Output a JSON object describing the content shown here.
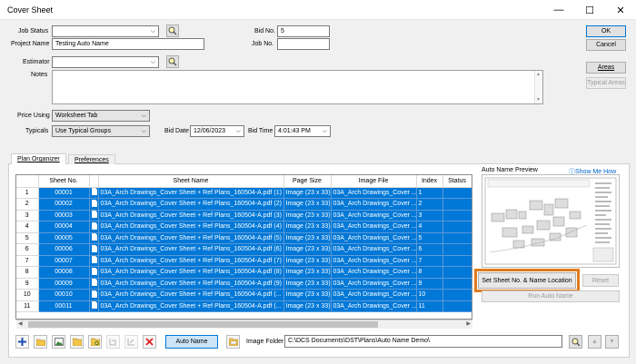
{
  "window": {
    "title": "Cover Sheet",
    "min": "—",
    "max": "☐",
    "close": "✕"
  },
  "form": {
    "job_status_label": "Job Status",
    "job_status_value": "",
    "project_name_label": "Project Name",
    "project_name_value": "Testing Auto Name",
    "estimator_label": "Estimator",
    "estimator_value": "",
    "notes_label": "Notes",
    "notes_value": "",
    "bid_no_label": "Bid No.",
    "bid_no_value": "5",
    "job_no_label": "Job No.",
    "job_no_value": "",
    "price_using_label": "Price Using",
    "price_using_value": "Worksheet Tab",
    "typicals_label": "Typicals",
    "typicals_value": "Use Typical Groups",
    "bid_date_label": "Bid Date",
    "bid_date_value": "12/06/2023",
    "bid_time_label": "Bid Time",
    "bid_time_value": "4:01:43 PM"
  },
  "side_buttons": {
    "ok": "OK",
    "cancel": "Cancel",
    "areas": "Areas",
    "typical_areas": "Typical Areas"
  },
  "tabs": [
    {
      "label": "Plan Organizer",
      "active": true
    },
    {
      "label": "Preferences",
      "active": false
    }
  ],
  "grid": {
    "columns": [
      "",
      "Sheet No.",
      "",
      "Sheet Name",
      "Page Size",
      "Image File",
      "Index",
      "Status",
      "Re"
    ],
    "rows": [
      {
        "num": "1",
        "sheet": "00001",
        "name": "03A_Arch Drawings_Cover Sheet + Ref Plans_160504-A.pdf (1)",
        "size": "Image (23 x 33)",
        "file": "03A_Arch Drawings_Cover ...",
        "index": "1"
      },
      {
        "num": "2",
        "sheet": "00002",
        "name": "03A_Arch Drawings_Cover Sheet + Ref Plans_160504-A.pdf (2)",
        "size": "Image (23 x 33)",
        "file": "03A_Arch Drawings_Cover ...",
        "index": "2"
      },
      {
        "num": "3",
        "sheet": "00003",
        "name": "03A_Arch Drawings_Cover Sheet + Ref Plans_160504-A.pdf (3)",
        "size": "Image (23 x 33)",
        "file": "03A_Arch Drawings_Cover ...",
        "index": "3"
      },
      {
        "num": "4",
        "sheet": "00004",
        "name": "03A_Arch Drawings_Cover Sheet + Ref Plans_160504-A.pdf (4)",
        "size": "Image (23 x 33)",
        "file": "03A_Arch Drawings_Cover ...",
        "index": "4"
      },
      {
        "num": "5",
        "sheet": "00005",
        "name": "03A_Arch Drawings_Cover Sheet + Ref Plans_160504-A.pdf (5)",
        "size": "Image (23 x 33)",
        "file": "03A_Arch Drawings_Cover ...",
        "index": "5"
      },
      {
        "num": "6",
        "sheet": "00006",
        "name": "03A_Arch Drawings_Cover Sheet + Ref Plans_160504-A.pdf (6)",
        "size": "Image (23 x 33)",
        "file": "03A_Arch Drawings_Cover ...",
        "index": "6"
      },
      {
        "num": "7",
        "sheet": "00007",
        "name": "03A_Arch Drawings_Cover Sheet + Ref Plans_160504-A.pdf (7)",
        "size": "Image (23 x 33)",
        "file": "03A_Arch Drawings_Cover ...",
        "index": "7"
      },
      {
        "num": "8",
        "sheet": "00008",
        "name": "03A_Arch Drawings_Cover Sheet + Ref Plans_160504-A.pdf (8)",
        "size": "Image (23 x 33)",
        "file": "03A_Arch Drawings_Cover ...",
        "index": "8"
      },
      {
        "num": "9",
        "sheet": "00009",
        "name": "03A_Arch Drawings_Cover Sheet + Ref Plans_160504-A.pdf (9)",
        "size": "Image (23 x 33)",
        "file": "03A_Arch Drawings_Cover ...",
        "index": "9"
      },
      {
        "num": "10",
        "sheet": "00010",
        "name": "03A_Arch Drawings_Cover Sheet + Ref Plans_160504-A.pdf (...",
        "size": "Image (23 x 33)",
        "file": "03A_Arch Drawings_Cover ...",
        "index": "10"
      },
      {
        "num": "11",
        "sheet": "00011",
        "name": "03A_Arch Drawings_Cover Sheet + Ref Plans_160504-A.pdf (...",
        "size": "Image (23 x 33)",
        "file": "03A_Arch Drawings_Cover ...",
        "index": "11"
      }
    ]
  },
  "preview": {
    "label": "Auto Name Preview",
    "show_me_how": "Show Me How",
    "set_button": "Set Sheet No. & Name Location",
    "reset_button": "Reset",
    "run_button": "Run Auto Name"
  },
  "bottom": {
    "auto_name_button": "Auto Name",
    "image_folder_label": "Image Folder",
    "image_folder_value": "C:\\DCS Documents\\DST\\Plans\\Auto Name Demo\\"
  },
  "colors": {
    "selection": "#0078d7",
    "highlight": "#e07b1e",
    "link": "#0066cc"
  }
}
